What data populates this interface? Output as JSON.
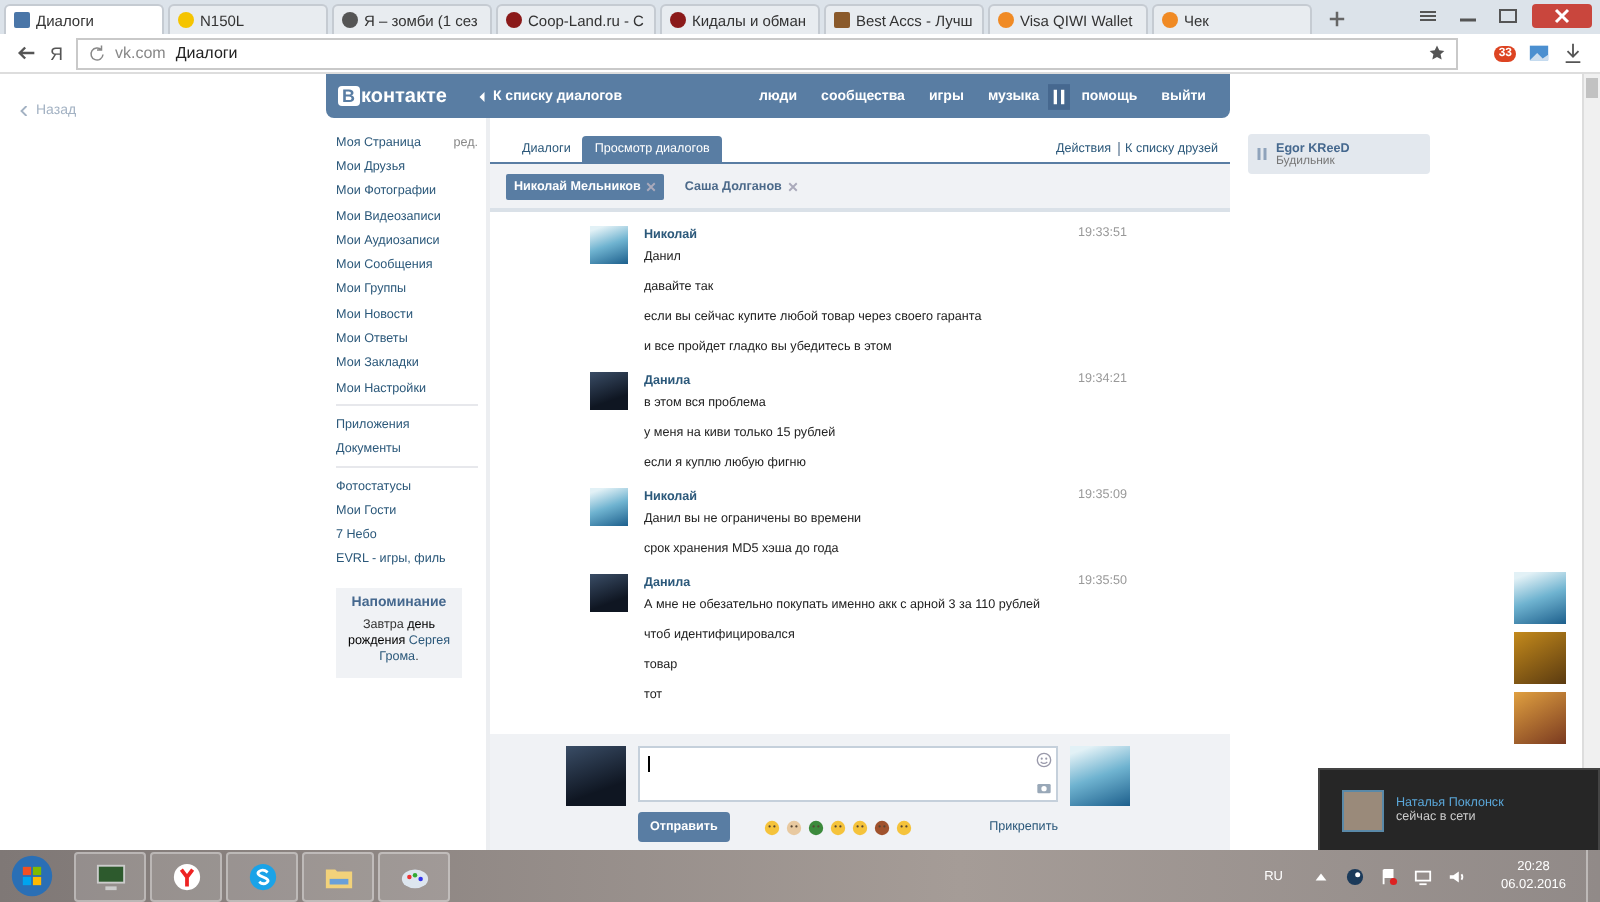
{
  "browser": {
    "tabs": [
      {
        "title": "Диалоги",
        "kind": "vk",
        "selected": true
      },
      {
        "title": "N150L",
        "kind": "beeline",
        "selected": false
      },
      {
        "title": "Я – зомби (1 сез",
        "kind": "round",
        "selected": false
      },
      {
        "title": "Coop-Land.ru - С",
        "kind": "coop",
        "selected": false
      },
      {
        "title": "Кидалы и обман",
        "kind": "coop",
        "selected": false
      },
      {
        "title": "Best Accs - Лучш",
        "kind": "book",
        "selected": false
      },
      {
        "title": "Visa QIWI Wallet",
        "kind": "qiwi",
        "selected": false
      },
      {
        "title": "Чек",
        "kind": "qiwi",
        "selected": false
      }
    ],
    "yandex_button": "Я",
    "address": {
      "domain": "vk.com",
      "path": "Диалоги"
    },
    "extension_badge": "33"
  },
  "page": {
    "back_link": "Назад",
    "header": {
      "logo_letter": "В",
      "logo_text": "контакте",
      "back_to_list": "К списку диалогов",
      "nav": [
        {
          "kind": "link",
          "label": "люди"
        },
        {
          "kind": "link",
          "label": "сообщества"
        },
        {
          "kind": "link",
          "label": "игры"
        },
        {
          "kind": "link",
          "label": "музыка"
        },
        {
          "kind": "pause"
        },
        {
          "kind": "link",
          "label": "помощь"
        },
        {
          "kind": "link",
          "label": "выйти"
        }
      ]
    },
    "sidebar": {
      "groups": [
        [
          {
            "label": "Моя Страница",
            "edit": "ред."
          },
          {
            "label": "Мои Друзья"
          },
          {
            "label": "Мои Фотографии"
          },
          {
            "label": "Мои Видеозаписи"
          },
          {
            "label": "Мои Аудиозаписи"
          },
          {
            "label": "Мои Сообщения"
          },
          {
            "label": "Мои Группы"
          },
          {
            "label": "Мои Новости"
          },
          {
            "label": "Мои Ответы"
          },
          {
            "label": "Мои Закладки"
          },
          {
            "label": "Мои Настройки"
          }
        ],
        [
          {
            "label": "Приложения"
          },
          {
            "label": "Документы"
          }
        ],
        [
          {
            "label": "Фотостатусы"
          },
          {
            "label": "Мои Гости"
          },
          {
            "label": "7 Небо"
          },
          {
            "label": "EVRL - игры, филь"
          }
        ]
      ],
      "reminder": {
        "title": "Напоминание",
        "parts": [
          {
            "kind": "plain",
            "text": "Завтра "
          },
          {
            "kind": "strong",
            "text": "день рождения"
          },
          {
            "kind": "link",
            "text": " Сергея Грома"
          },
          {
            "kind": "plain",
            "text": "."
          }
        ]
      }
    },
    "dialog": {
      "tabs": [
        {
          "label": "Диалоги",
          "selected": false
        },
        {
          "label": "Просмотр диалогов",
          "selected": true
        }
      ],
      "actions": [
        "Действия",
        "К списку друзей"
      ],
      "chips": [
        {
          "name": "Николай Мельников",
          "selected": true
        },
        {
          "name": "Саша Долганов",
          "selected": false
        }
      ],
      "messages": [
        {
          "author": "Николай",
          "kind": "sea",
          "time": "19:33:51",
          "lines": [
            "Данил",
            "давайте так",
            "если вы сейчас купите любой товар через своего гаранта",
            "и все пройдет гладко вы убедитесь в этом"
          ]
        },
        {
          "author": "Данила",
          "kind": "car",
          "time": "19:34:21",
          "lines": [
            "в этом вся проблема",
            "у меня на киви только 15 рублей",
            "если я куплю любую фигню"
          ]
        },
        {
          "author": "Николай",
          "kind": "sea",
          "time": "19:35:09",
          "lines": [
            "Данил вы не ограничены во времени",
            "срок хранения MD5 хэша до года"
          ]
        },
        {
          "author": "Данила",
          "kind": "car",
          "time": "19:35:50",
          "lines": [
            "А мне не обезательно покупать именно акк с арной 3 за 110 рублей",
            "чтоб идентифицировался",
            "товар",
            "тот"
          ]
        }
      ],
      "compose": {
        "send": "Отправить",
        "attach": "Прикрепить"
      }
    },
    "player": {
      "title": "Egor KReeD",
      "subtitle": "Будильник"
    }
  },
  "notification": {
    "name": "Наталья Поклонск",
    "status": "сейчас в сети"
  },
  "taskbar": {
    "language": "RU",
    "time": "20:28",
    "date": "06.02.2016"
  }
}
